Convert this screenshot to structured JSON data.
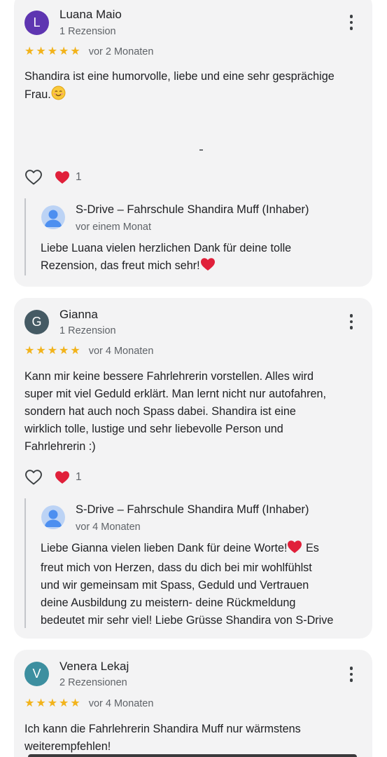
{
  "reviews": [
    {
      "avatar_letter": "L",
      "avatar_color": "#5e35b1",
      "name": "Luana Maio",
      "review_count": "1 Rezension",
      "stars": 5,
      "date": "vor 2 Monaten",
      "text_line1": "Shandira ist eine humorvolle, liebe und eine sehr gesprächige",
      "text_line2": "Frau.",
      "reaction_count": "1",
      "owner_reply": {
        "name": "S-Drive – Fahrschule Shandira Muff (Inhaber)",
        "date": "vor einem Monat",
        "line1": "Liebe Luana vielen herzlichen Dank für deine tolle",
        "line2": "Rezension, das freut mich sehr!"
      }
    },
    {
      "avatar_letter": "G",
      "avatar_color": "#455a64",
      "name": "Gianna",
      "review_count": "1 Rezension",
      "stars": 5,
      "date": "vor 4 Monaten",
      "text_lines": [
        "Kann mir keine bessere Fahrlehrerin vorstellen. Alles wird",
        "super mit viel Geduld erklärt. Man lernt nicht nur autofahren,",
        "sondern hat auch noch Spass dabei. Shandira ist eine",
        "wirklich tolle, lustige und sehr liebevolle Person und",
        "Fahrlehrerin :)"
      ],
      "reaction_count": "1",
      "owner_reply": {
        "name": "S-Drive – Fahrschule Shandira Muff (Inhaber)",
        "date": "vor 4 Monaten",
        "line1a": "Liebe Gianna vielen lieben Dank für deine Worte!",
        "line1b": " Es",
        "lines": [
          "freut mich von Herzen, dass du dich bei mir wohlfühlst",
          "und wir gemeinsam mit Spass, Geduld und Vertrauen",
          "deine Ausbildung zu meistern- deine Rückmeldung",
          "bedeutet mir sehr viel! Liebe Grüsse Shandira von S-Drive"
        ]
      }
    },
    {
      "avatar_letter": "V",
      "avatar_color": "#3d8fa0",
      "name": "Venera Lekaj",
      "review_count": "2 Rezensionen",
      "stars": 5,
      "date": "vor 4 Monaten",
      "text_lines": [
        "Ich kann die Fahrlehrerin Shandira Muff nur wärmstens",
        "weiterempfehlen!"
      ]
    }
  ],
  "icons": {
    "star": "star-icon",
    "more": "more-vert-icon",
    "like": "heart-outline-icon",
    "reaction": "red-heart-emoji",
    "smile": "smiling-face-emoji",
    "owner": "default-profile-icon"
  },
  "colors": {
    "star": "#f2b31b",
    "heart": "#e0203a",
    "card": "#f3f3f4"
  }
}
